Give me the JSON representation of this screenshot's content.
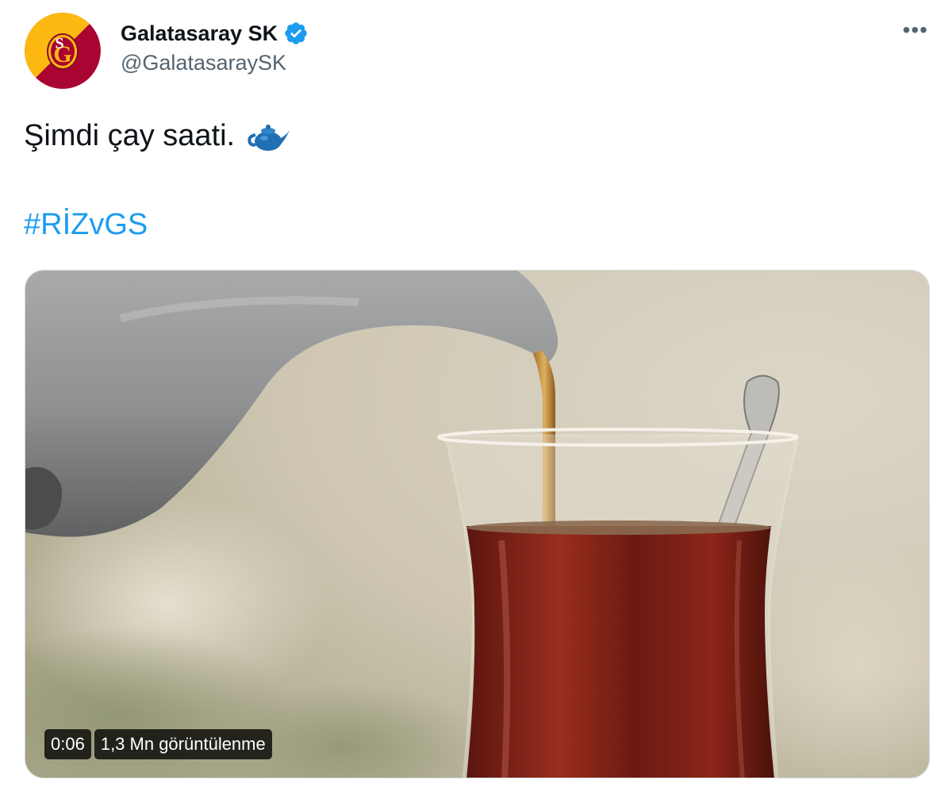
{
  "author": {
    "display_name": "Galatasaray SK",
    "handle": "@GalatasaraySK",
    "verified": true
  },
  "tweet": {
    "text": "Şimdi çay saati.",
    "emoji": "teapot-icon",
    "hashtag": "#RİZvGS"
  },
  "media": {
    "type": "video",
    "duration": "0:06",
    "views": "1,3 Mn görüntülenme"
  },
  "colors": {
    "link": "#1d9bf0",
    "text": "#0f1419",
    "secondary": "#536471",
    "verified": "#1d9bf0",
    "club_red": "#a90432",
    "club_yellow": "#fdb912"
  }
}
